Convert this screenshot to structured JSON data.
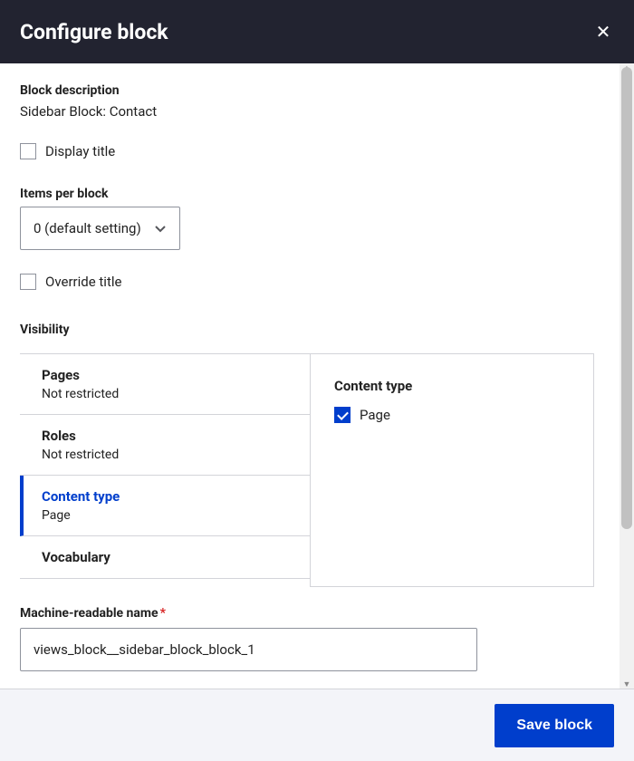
{
  "header": {
    "title": "Configure block"
  },
  "block_description": {
    "label": "Block description",
    "value": "Sidebar Block: Contact"
  },
  "display_title": {
    "label": "Display title",
    "checked": false
  },
  "items_per_block": {
    "label": "Items per block",
    "selected": "0 (default setting)"
  },
  "override_title": {
    "label": "Override title",
    "checked": false
  },
  "visibility": {
    "heading": "Visibility",
    "tabs": [
      {
        "title": "Pages",
        "subtitle": "Not restricted",
        "active": false
      },
      {
        "title": "Roles",
        "subtitle": "Not restricted",
        "active": false
      },
      {
        "title": "Content type",
        "subtitle": "Page",
        "active": true
      },
      {
        "title": "Vocabulary",
        "subtitle": "",
        "active": false
      }
    ],
    "panel": {
      "heading": "Content type",
      "option_label": "Page",
      "option_checked": true
    }
  },
  "machine_name": {
    "label": "Machine-readable name",
    "required": true,
    "value": "views_block__sidebar_block_block_1"
  },
  "footer": {
    "save_label": "Save block"
  }
}
